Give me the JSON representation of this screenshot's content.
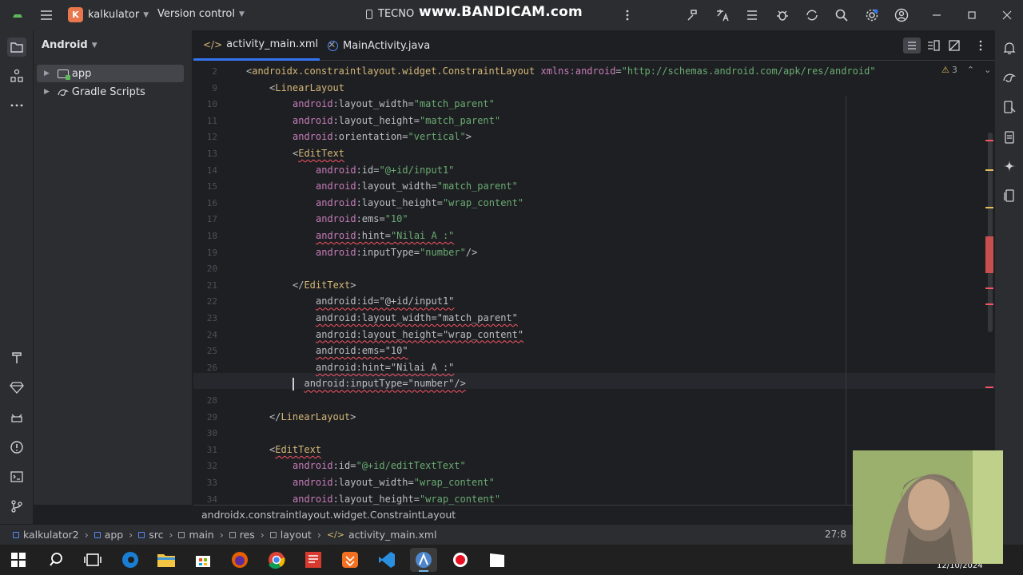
{
  "titlebar": {
    "project_initial": "K",
    "project_name": "kalkulator",
    "vcs_label": "Version control",
    "device": "TECNO",
    "watermark": "www.BANDICAM.com"
  },
  "project_panel": {
    "view": "Android",
    "items": [
      {
        "label": "app",
        "selected": true
      },
      {
        "label": "Gradle Scripts",
        "selected": false
      }
    ]
  },
  "tabs": [
    {
      "label": "activity_main.xml",
      "active": true
    },
    {
      "label": "MainActivity.java",
      "active": false
    }
  ],
  "editor": {
    "warning_count": "3",
    "current_line": "27",
    "lines": [
      {
        "n": "2",
        "indent": 0,
        "parts": [
          [
            "p",
            "<"
          ],
          [
            "t",
            "androidx.constraintlayout.widget.ConstraintLayout"
          ],
          [
            "p",
            " "
          ],
          [
            "a",
            "xmlns:"
          ],
          [
            "ns",
            "android"
          ],
          [
            "p",
            "="
          ],
          [
            "s",
            "\"http://schemas.android.com/apk/res/android\""
          ]
        ]
      },
      {
        "n": "9",
        "indent": 4,
        "parts": [
          [
            "p",
            "<"
          ],
          [
            "t",
            "LinearLayout"
          ]
        ]
      },
      {
        "n": "10",
        "indent": 8,
        "parts": [
          [
            "a",
            "android"
          ],
          [
            "p",
            ":layout_width="
          ],
          [
            "s",
            "\"match_parent\""
          ]
        ]
      },
      {
        "n": "11",
        "indent": 8,
        "parts": [
          [
            "a",
            "android"
          ],
          [
            "p",
            ":layout_height="
          ],
          [
            "s",
            "\"match_parent\""
          ]
        ]
      },
      {
        "n": "12",
        "indent": 8,
        "parts": [
          [
            "a",
            "android"
          ],
          [
            "p",
            ":orientation="
          ],
          [
            "s",
            "\"vertical\""
          ],
          [
            "p",
            ">"
          ]
        ]
      },
      {
        "n": "13",
        "indent": 8,
        "parts": [
          [
            "p",
            "<"
          ],
          [
            "t",
            "EditText"
          ]
        ]
      },
      {
        "n": "14",
        "indent": 12,
        "parts": [
          [
            "a",
            "android"
          ],
          [
            "p",
            ":id="
          ],
          [
            "s",
            "\"@+id/input1\""
          ]
        ]
      },
      {
        "n": "15",
        "indent": 12,
        "parts": [
          [
            "a",
            "android"
          ],
          [
            "p",
            ":layout_width="
          ],
          [
            "s",
            "\"match_parent\""
          ]
        ]
      },
      {
        "n": "16",
        "indent": 12,
        "parts": [
          [
            "a",
            "android"
          ],
          [
            "p",
            ":layout_height="
          ],
          [
            "s",
            "\"wrap_content\""
          ]
        ]
      },
      {
        "n": "17",
        "indent": 12,
        "parts": [
          [
            "a",
            "android"
          ],
          [
            "p",
            ":ems="
          ],
          [
            "s",
            "\"10\""
          ]
        ]
      },
      {
        "n": "18",
        "indent": 12,
        "parts": [
          [
            "a",
            "android"
          ],
          [
            "p",
            ":hint="
          ],
          [
            "s",
            "\"Nilai A :\""
          ]
        ]
      },
      {
        "n": "19",
        "indent": 12,
        "parts": [
          [
            "a",
            "android"
          ],
          [
            "p",
            ":inputType="
          ],
          [
            "s",
            "\"number\""
          ],
          [
            "p",
            "/>"
          ]
        ]
      },
      {
        "n": "20",
        "indent": 0,
        "parts": []
      },
      {
        "n": "21",
        "indent": 8,
        "parts": [
          [
            "p",
            "</"
          ],
          [
            "t",
            "EditText"
          ],
          [
            "p",
            ">"
          ]
        ]
      },
      {
        "n": "22",
        "indent": 12,
        "parts": [
          [
            "p",
            "android:id=\"@+id/input1\""
          ]
        ]
      },
      {
        "n": "23",
        "indent": 12,
        "parts": [
          [
            "p",
            "android:layout_width=\"match_parent\""
          ]
        ]
      },
      {
        "n": "24",
        "indent": 12,
        "parts": [
          [
            "p",
            "android:layout_height=\"wrap_content\""
          ]
        ]
      },
      {
        "n": "25",
        "indent": 12,
        "parts": [
          [
            "p",
            "android:ems=\"10\""
          ]
        ]
      },
      {
        "n": "26",
        "indent": 12,
        "parts": [
          [
            "p",
            "android:hint=\"Nilai A :\""
          ]
        ]
      },
      {
        "n": "27",
        "indent": 10,
        "parts": [
          [
            "p",
            "android:inputType=\"number\"/>"
          ]
        ]
      },
      {
        "n": "28",
        "indent": 0,
        "parts": []
      },
      {
        "n": "29",
        "indent": 4,
        "parts": [
          [
            "p",
            "</"
          ],
          [
            "t",
            "LinearLayout"
          ],
          [
            "p",
            ">"
          ]
        ]
      },
      {
        "n": "30",
        "indent": 0,
        "parts": []
      },
      {
        "n": "31",
        "indent": 4,
        "parts": [
          [
            "p",
            "<"
          ],
          [
            "t",
            "EditText"
          ]
        ]
      },
      {
        "n": "32",
        "indent": 8,
        "parts": [
          [
            "a",
            "android"
          ],
          [
            "p",
            ":id="
          ],
          [
            "s",
            "\"@+id/editTextText\""
          ]
        ]
      },
      {
        "n": "33",
        "indent": 8,
        "parts": [
          [
            "a",
            "android"
          ],
          [
            "p",
            ":layout_width="
          ],
          [
            "s",
            "\"wrap_content\""
          ]
        ]
      },
      {
        "n": "34",
        "indent": 8,
        "parts": [
          [
            "a",
            "android"
          ],
          [
            "p",
            ":layout_height="
          ],
          [
            "s",
            "\"wrap_content\""
          ]
        ]
      }
    ]
  },
  "status": {
    "path_hint": "androidx.constraintlayout.widget.ConstraintLayout",
    "position": "27:8"
  },
  "breadcrumbs": [
    "kalkulator2",
    "app",
    "src",
    "main",
    "res",
    "layout",
    "activity_main.xml"
  ],
  "taskbar": {
    "date": "12/10/2024"
  },
  "colors": {
    "accent": "#3574f0",
    "error": "#f75464",
    "warning": "#e0c05a",
    "project_badge": "#e8774d"
  }
}
